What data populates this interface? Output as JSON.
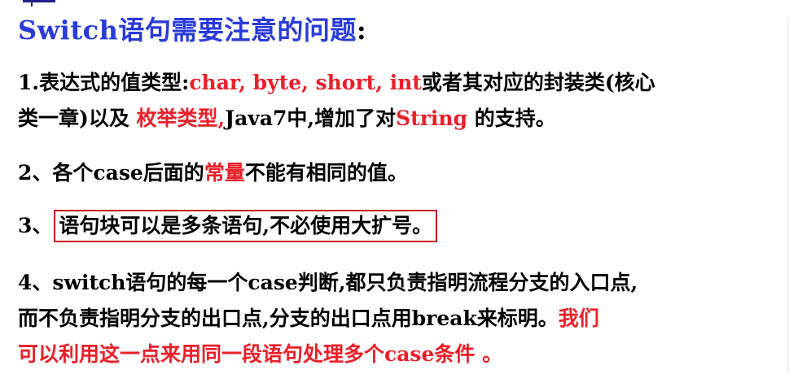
{
  "title": {
    "text": "Switch语句需要注意的问题",
    "colon": ":"
  },
  "points": [
    {
      "line1": {
        "a": "1.表达式的值类型:",
        "b_red": "char, byte, short, int",
        "c": "或者其对应的封装类(核心"
      },
      "line2": {
        "a": "类一章)以及 ",
        "b_red": "枚举类型,",
        "c": "Java7中,增加了对",
        "d_red": "String",
        "e": " 的支持。"
      }
    },
    {
      "a": "2、各个case后面的",
      "b_red": "常量",
      "c": "不能有相同的值。"
    },
    {
      "prefix": "3、",
      "boxed": "语句块可以是多条语句,不必使用大扩号。"
    },
    {
      "line1": "4、switch语句的每一个case判断,都只负责指明流程分支的入口点,",
      "line2": {
        "a": "而不负责指明分支的出口点,分支的出口点用break来标明。",
        "b_red": "我们"
      },
      "line3_red": "可以利用这一点来用同一段语句处理多个case条件 。"
    }
  ],
  "colors": {
    "title": "#2a3ad8",
    "highlight": "#e8202a",
    "box_border": "#c8141e",
    "text": "#000000"
  }
}
